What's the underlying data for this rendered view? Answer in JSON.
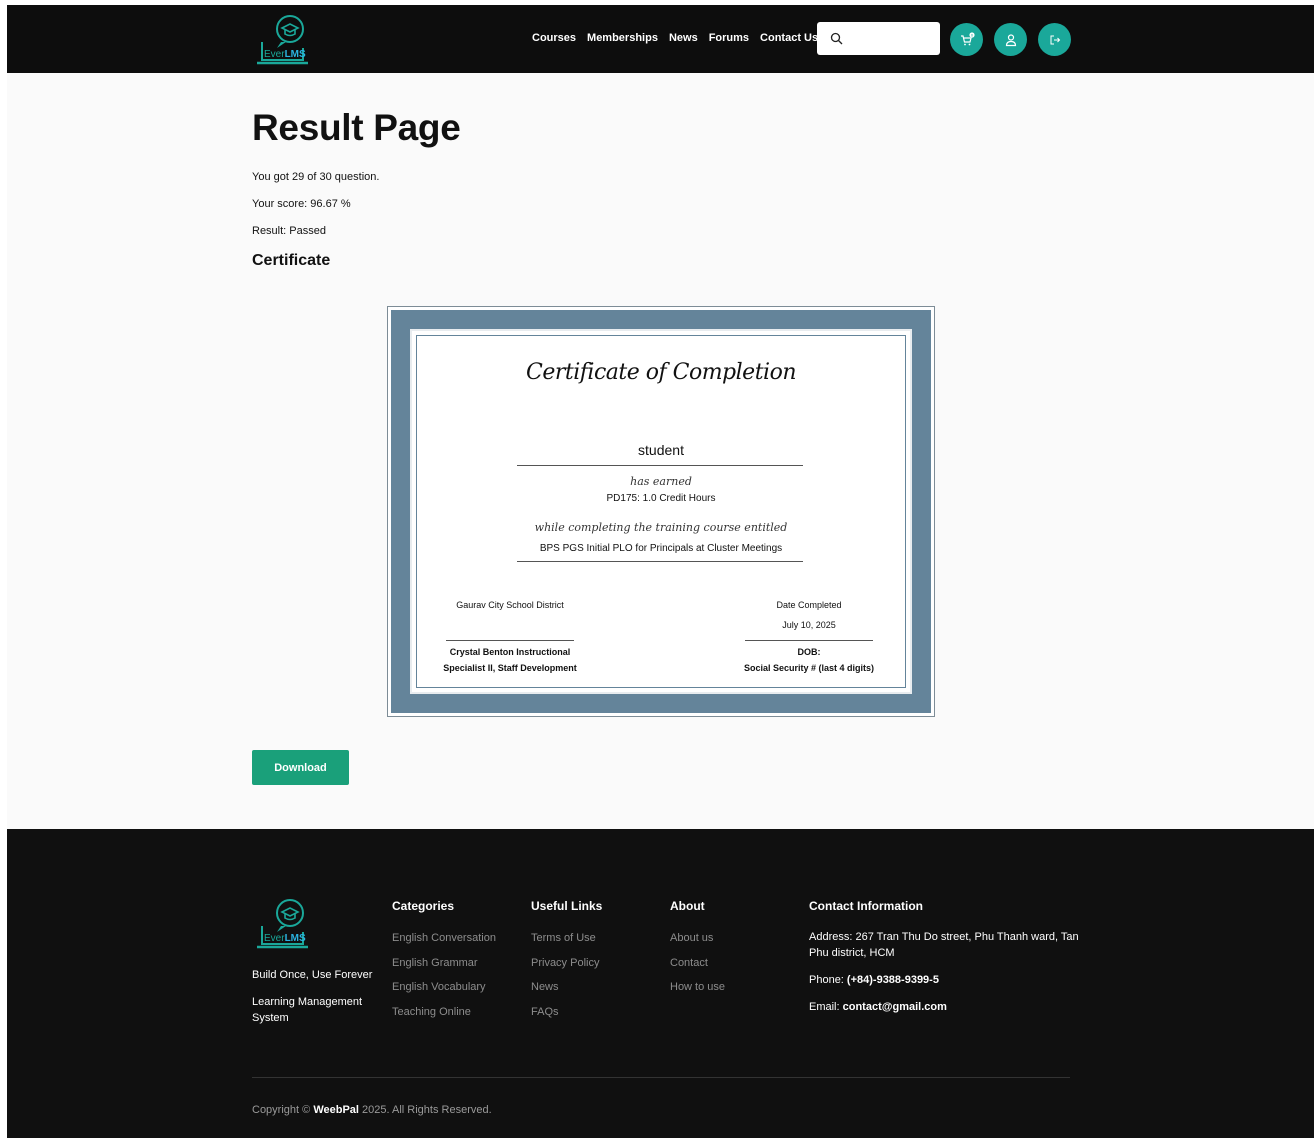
{
  "brand": {
    "name_prefix": "Ever",
    "name_suffix": "LMS"
  },
  "nav": [
    "Courses",
    "Memberships",
    "News",
    "Forums",
    "Contact Us"
  ],
  "search": {
    "value": "",
    "placeholder": ""
  },
  "cart": {
    "count": "0"
  },
  "main": {
    "title": "Result Page",
    "questions_line": "You got 29 of 30 question.",
    "score_line": "Your score: 96.67 %",
    "result_line": "Result: Passed",
    "certificate_title": "Certificate"
  },
  "certificate": {
    "heading": "Certificate of Completion",
    "student": "student",
    "has_earned": "has earned",
    "credit": "PD175: 1.0 Credit Hours",
    "while_completing": "while completing the training course entitled",
    "course": "BPS PGS Initial PLO for Principals at Cluster Meetings",
    "district": "Gaurav City School District",
    "date_label": "Date Completed",
    "date_value": "July 10, 2025",
    "signer_line1": "Crystal Benton Instructional",
    "signer_line2": "Specialist II, Staff Development",
    "dob_label": "DOB:",
    "ssn_label": "Social Security # (last 4 digits)"
  },
  "download_label": "Download",
  "footer": {
    "tagline": "Build Once, Use Forever",
    "subtitle": "Learning Management System",
    "categories": {
      "title": "Categories",
      "items": [
        "English Conversation",
        "English Grammar",
        "English Vocabulary",
        "Teaching Online"
      ]
    },
    "useful_links": {
      "title": "Useful Links",
      "items": [
        "Terms of Use",
        "Privacy Policy",
        "News",
        "FAQs"
      ]
    },
    "about": {
      "title": "About",
      "items": [
        "About us",
        "Contact",
        "How to use"
      ]
    },
    "contact": {
      "title": "Contact Information",
      "address": "Address: 267 Tran Thu Do street, Phu Thanh ward, Tan Phu district, HCM",
      "phone_label": "Phone: ",
      "phone": "(+84)-9388-9399-5",
      "email_label": "Email: ",
      "email": "contact@gmail.com"
    },
    "copyright_prefix": "Copyright ©",
    "copyright_brand": "WeebPal",
    "copyright_suffix": " 2025. All Rights Reserved."
  },
  "colors": {
    "accent": "#1aa89a",
    "download": "#1aa07a",
    "cert_border": "#64849a",
    "dark": "#0d0d0d"
  }
}
